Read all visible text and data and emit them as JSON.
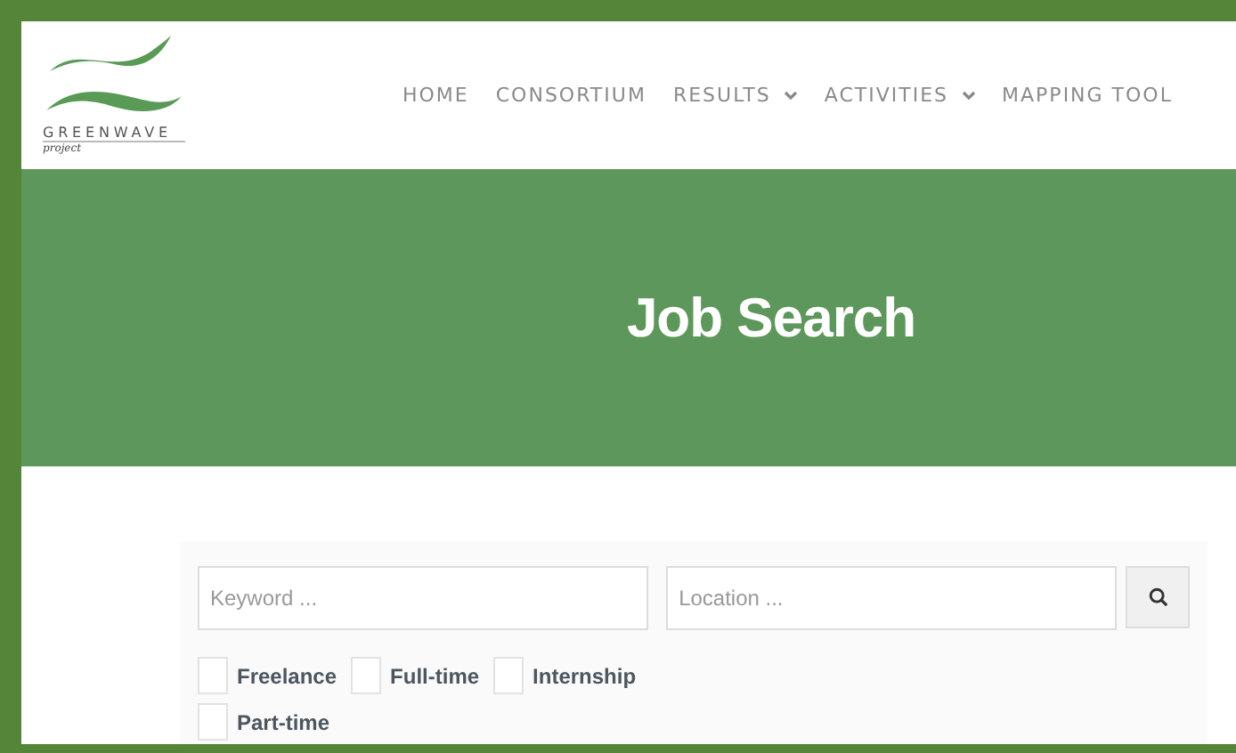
{
  "logo": {
    "name": "GREENWAVE",
    "tagline": "project"
  },
  "nav": [
    {
      "label": "HOME",
      "has_dropdown": false
    },
    {
      "label": "CONSORTIUM",
      "has_dropdown": false
    },
    {
      "label": "RESULTS",
      "has_dropdown": true
    },
    {
      "label": "ACTIVITIES",
      "has_dropdown": true
    },
    {
      "label": "MAPPING TOOL",
      "has_dropdown": false
    }
  ],
  "banner": {
    "title": "Job Search"
  },
  "search": {
    "keyword_placeholder": "Keyword ...",
    "location_placeholder": "Location ..."
  },
  "job_types": [
    {
      "label": "Freelance",
      "checked": false
    },
    {
      "label": "Full-time",
      "checked": false
    },
    {
      "label": "Internship",
      "checked": false
    },
    {
      "label": "Part-time",
      "checked": false
    }
  ]
}
